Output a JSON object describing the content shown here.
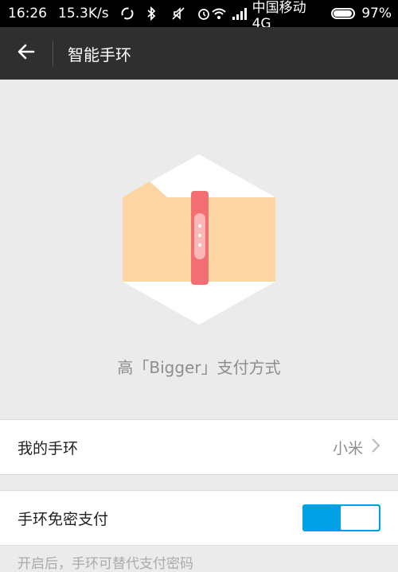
{
  "status_bar": {
    "time": "16:26",
    "speed": "15.3K/s",
    "carrier": "中国移动 4G",
    "battery_percent": "97%",
    "battery_level": 0.97
  },
  "app_bar": {
    "title": "智能手环",
    "back_icon": "arrow-left-icon"
  },
  "hero": {
    "caption": "高「Bigger」支付方式",
    "colors": {
      "hexagon": "#ffffff",
      "skin": "#fcd5a3",
      "band": "#f36e72"
    }
  },
  "settings": {
    "my_band": {
      "label": "我的手环",
      "value": "小米"
    },
    "band_payment": {
      "label": "手环免密支付",
      "enabled": true
    },
    "hint": "开启后，手环可替代支付密码"
  },
  "colors": {
    "accent": "#00a0e4",
    "app_bar_bg": "#2f2f2f"
  }
}
